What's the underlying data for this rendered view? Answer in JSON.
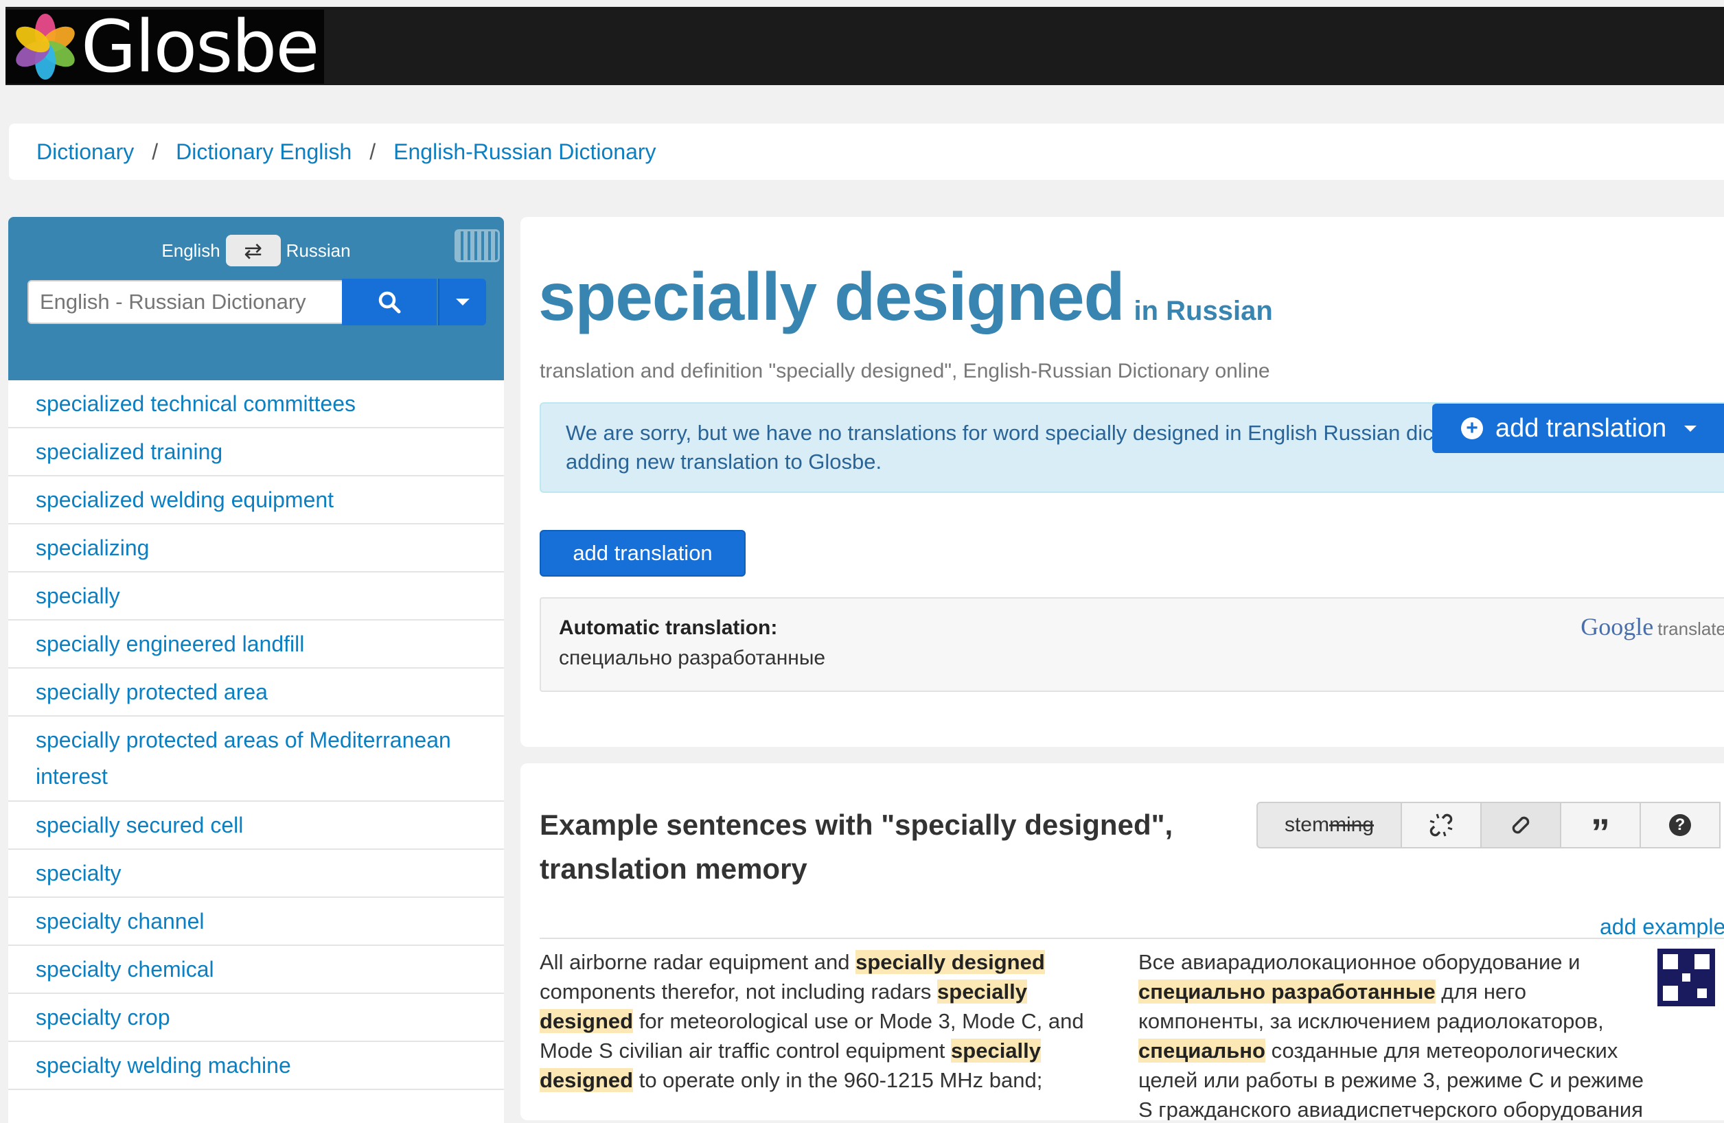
{
  "header": {
    "logo_text": "Glosbe"
  },
  "breadcrumb": {
    "items": [
      "Dictionary",
      "Dictionary English",
      "English-Russian Dictionary"
    ],
    "separator": "/"
  },
  "sidebar": {
    "from_lang": "English",
    "to_lang": "Russian",
    "search_placeholder": "English - Russian Dictionary",
    "items": [
      "specialized technical committees",
      "specialized training",
      "specialized welding equipment",
      "specializing",
      "specially",
      "specially engineered landfill",
      "specially protected area",
      "specially protected areas of Mediterranean interest",
      "specially secured cell",
      "specialty",
      "specialty channel",
      "specialty chemical",
      "specialty crop",
      "specialty welding machine"
    ]
  },
  "main": {
    "word": "specially designed",
    "in_language": "in Russian",
    "subtitle": "translation and definition \"specially designed\", English-Russian Dictionary  online",
    "alert_text": "We are sorry, but we have no translations for word specially designed in English Russian dictionary. Please, consider adding new translation to Glosbe.",
    "add_translation_dropdown": "add translation",
    "add_translation_button": "add translation",
    "auto_label": "Automatic translation:",
    "auto_text": "специально разработанные",
    "google_word": "Google",
    "google_suffix": "translate"
  },
  "examples": {
    "title": "Example sentences with \"specially designed\", translation memory",
    "stemming_prefix": "stem",
    "stemming_struck": "ming",
    "add_example": "add example",
    "en": {
      "p1": "All airborne radar equipment and ",
      "h1": "specially designed",
      "p2": " components therefor, not including radars ",
      "h2": "specially designed",
      "p3": " for meteorological use or Mode 3, Mode C, and Mode S civilian air traffic control equipment ",
      "h3": "specially designed",
      "p4": " to operate only in the 960-1215 MHz band;"
    },
    "ru": {
      "p1": "Все авиарадиолокационное оборудование и ",
      "h1": "специально разработанные",
      "p2": " для него компоненты, за исключением радиолокаторов, ",
      "h2": "специально",
      "p3": " созданные для метеорологических целей или работы в режиме 3, режиме С и режиме S гражданского авиадиспетчерского оборудования"
    }
  },
  "colors": {
    "accent_blue": "#3785b0",
    "button_blue": "#1670d8",
    "link_blue": "#0b7fc1",
    "highlight": "#fbe8b4"
  },
  "icons": [
    "logo-flower-icon",
    "swap-icon",
    "keyboard-icon",
    "search-icon",
    "chevron-down-icon",
    "plus-circle-icon",
    "unlink-icon",
    "link-icon",
    "quote-icon",
    "help-icon",
    "qr-code-icon"
  ]
}
